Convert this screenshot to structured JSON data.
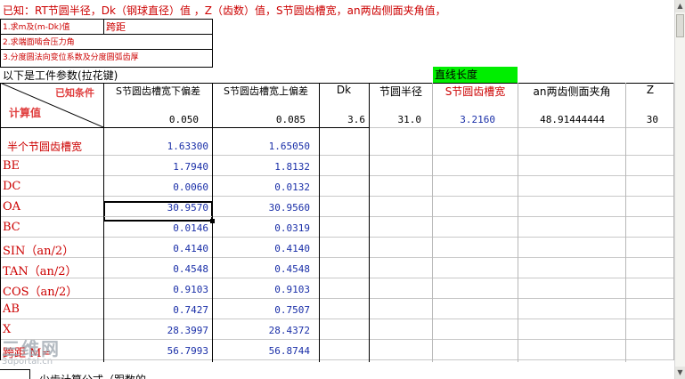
{
  "title_line": "已知：RT节圆半径，Dk（钢球直径）值 ，Z（齿数）值，S节圆齿槽宽，an两齿侧面夹角值，",
  "tasks": [
    "1.求m及(m-Dk)值",
    "2.求端面啮合压力角",
    "3.分度圆法向变位系数及分度圆弧齿厚"
  ],
  "task_note": "跨距",
  "section_label": "以下是工件参数(拉花键)",
  "straight_length_label": "直线长度",
  "diag_header": {
    "top": "已知条件",
    "bottom": "计算值"
  },
  "columns": [
    {
      "header": "S节圆齿槽宽下偏差",
      "value": "0.050"
    },
    {
      "header": "S节圆齿槽宽上偏差",
      "value": "0.085"
    },
    {
      "header": "Dk",
      "value": "3.6"
    },
    {
      "header": "节圆半径",
      "value": "31.0"
    },
    {
      "header": "S节圆齿槽宽",
      "value": "3.2160"
    },
    {
      "header": "an两齿侧面夹角",
      "value": "48.91444444"
    },
    {
      "header": "Z",
      "value": "30"
    }
  ],
  "rows": [
    {
      "label": "半个节圆齿槽宽",
      "v1": "1.63300",
      "v2": "1.65050"
    },
    {
      "label": "BE",
      "v1": "1.7940",
      "v2": "1.8132"
    },
    {
      "label": "DC",
      "v1": "0.0060",
      "v2": "0.0132"
    },
    {
      "label": "OA",
      "v1": "30.9570",
      "v2": "30.9560"
    },
    {
      "label": "BC",
      "v1": "0.0146",
      "v2": "0.0319"
    },
    {
      "label": "SIN（an/2）",
      "v1": "0.4140",
      "v2": "0.4140"
    },
    {
      "label": "TAN（an/2）",
      "v1": "0.4548",
      "v2": "0.4548"
    },
    {
      "label": "COS（an/2）",
      "v1": "0.9103",
      "v2": "0.9103"
    },
    {
      "label": "AB",
      "v1": "0.7427",
      "v2": "0.7507"
    },
    {
      "label": "X",
      "v1": "28.3997",
      "v2": "28.4372"
    },
    {
      "label": "跨距 M=",
      "v1": "56.7993",
      "v2": "56.8744"
    }
  ],
  "bottom_tab_fragment": "少齿计算公式（跟数的",
  "watermark": {
    "big": "三维网",
    "small": "3dportal.cn"
  },
  "colors": {
    "red": "#cc0000",
    "blue": "#1a2fa8",
    "green": "#00ee00",
    "grid": "#b8b8b8"
  }
}
